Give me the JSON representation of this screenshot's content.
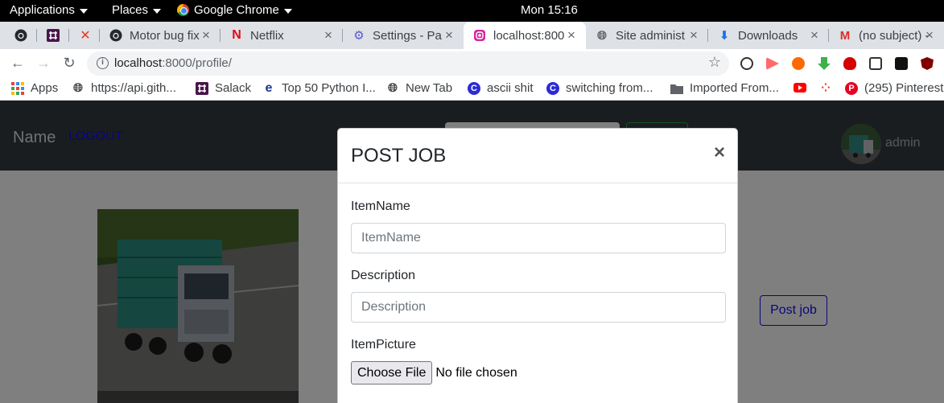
{
  "system_bar": {
    "applications": "Applications",
    "places": "Places",
    "browser": "Google Chrome",
    "clock": "Mon 15:16"
  },
  "tabs": [
    {
      "title": "",
      "icon": "github-icon"
    },
    {
      "title": "",
      "icon": "slack-icon"
    },
    {
      "title": "",
      "icon": "x-icon"
    },
    {
      "title": "Motor bug fix",
      "icon": "github-icon"
    },
    {
      "title": "Netflix",
      "icon": "netflix-icon"
    },
    {
      "title": "Settings - Pa",
      "icon": "gear-icon"
    },
    {
      "title": "localhost:800",
      "icon": "instagram-icon",
      "active": true
    },
    {
      "title": "Site administ",
      "icon": "globe-icon"
    },
    {
      "title": "Downloads",
      "icon": "download-icon"
    },
    {
      "title": "(no subject) -",
      "icon": "gmail-icon"
    }
  ],
  "address_bar": {
    "host": "localhost",
    "path": ":8000/profile/"
  },
  "bookmarks": [
    {
      "label": "Apps",
      "icon": "apps-grid-icon"
    },
    {
      "label": "https://api.gith...",
      "icon": "globe-icon"
    },
    {
      "label": "Salack",
      "icon": "slack-icon"
    },
    {
      "label": "Top 50 Python I...",
      "icon": "edureka-icon"
    },
    {
      "label": "New Tab",
      "icon": "globe-icon"
    },
    {
      "label": "ascii shit",
      "icon": "c-icon"
    },
    {
      "label": "switching from...",
      "icon": "c-icon"
    },
    {
      "label": "Imported From...",
      "icon": "folder-icon"
    },
    {
      "label": "",
      "icon": "youtube-icon"
    },
    {
      "label": "",
      "icon": "dots-icon"
    },
    {
      "label": "(295) Pinterest",
      "icon": "pinterest-icon"
    }
  ],
  "site": {
    "brand": "Name",
    "logout": "LOGOUT",
    "username": "admin",
    "post_job_button": "Post job"
  },
  "modal": {
    "title": "POST JOB",
    "close": "×",
    "item_name_label": "ItemName",
    "item_name_placeholder": "ItemName",
    "description_label": "Description",
    "description_placeholder": "Description",
    "item_picture_label": "ItemPicture",
    "choose_file": "Choose File",
    "file_status": "No file chosen"
  },
  "colors": {
    "navbar": "#343a40",
    "link": "#0d0dff",
    "overlay": "rgba(0,0,0,0.5)"
  }
}
